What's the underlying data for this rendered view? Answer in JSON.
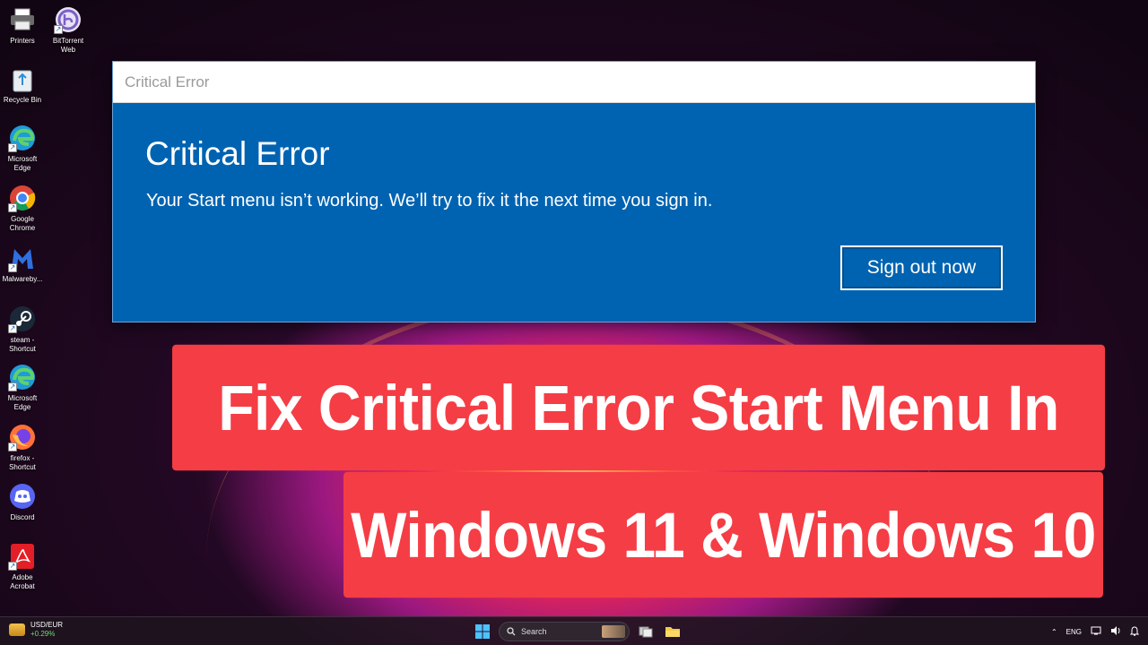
{
  "desktop": {
    "icons": [
      {
        "label": "Printers",
        "icon": "printer-icon"
      },
      {
        "label": "BitTorrent\nWeb",
        "icon": "bittorrent-icon"
      },
      {
        "label": "Recycle Bin",
        "icon": "recycle-bin-icon"
      },
      {
        "label": "Microsoft\nEdge",
        "icon": "edge-icon"
      },
      {
        "label": "Google\nChrome",
        "icon": "chrome-icon"
      },
      {
        "label": "Malwareby...",
        "icon": "malwarebytes-icon"
      },
      {
        "label": "steam -\nShortcut",
        "icon": "steam-icon"
      },
      {
        "label": "Microsoft\nEdge",
        "icon": "edge-icon"
      },
      {
        "label": "firefox -\nShortcut",
        "icon": "firefox-icon"
      },
      {
        "label": "Discord",
        "icon": "discord-icon"
      },
      {
        "label": "Adobe\nAcrobat",
        "icon": "acrobat-icon"
      }
    ]
  },
  "dialog": {
    "window_title": "Critical Error",
    "heading": "Critical Error",
    "message": "Your Start menu isn’t working. We’ll try to fix it the next time you sign in.",
    "button_label": "Sign out now",
    "background_color": "#0063b1"
  },
  "banners": {
    "line1": "Fix Critical Error Start Menu In",
    "line2": "Windows 11 & Windows 10",
    "background_color": "#f53d45"
  },
  "taskbar": {
    "widget_title": "USD/EUR",
    "widget_change": "+0.29%",
    "search_placeholder": "Search",
    "language": "ENG"
  }
}
